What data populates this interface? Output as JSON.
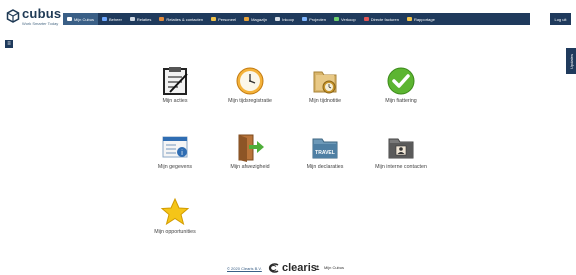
{
  "brand": {
    "name": "cubus",
    "tagline": "Work Smarter Today"
  },
  "nav": {
    "items": [
      {
        "label": "Mijn Cubus",
        "icon": "user-icon",
        "color": "#ffffff"
      },
      {
        "label": "Beheer",
        "icon": "cog-icon",
        "color": "#6ea8ff"
      },
      {
        "label": "Relaties",
        "icon": "contacts-icon",
        "color": "#cfd8e3"
      },
      {
        "label": "Relaties & contacten",
        "icon": "people-icon",
        "color": "#e08a3c"
      },
      {
        "label": "Personeel",
        "icon": "staff-icon",
        "color": "#f0c24a"
      },
      {
        "label": "Magazijn",
        "icon": "warehouse-icon",
        "color": "#e8a33a"
      },
      {
        "label": "Inkoop",
        "icon": "cart-icon",
        "color": "#d6dde6"
      },
      {
        "label": "Projecten",
        "icon": "projects-icon",
        "color": "#7fb6ff"
      },
      {
        "label": "Verkoop",
        "icon": "sales-icon",
        "color": "#6ccf6c"
      },
      {
        "label": "Directe facturen",
        "icon": "invoice-icon",
        "color": "#e25555"
      },
      {
        "label": "Rapportage",
        "icon": "report-icon",
        "color": "#f0c24a"
      }
    ],
    "logout_label": "Log uit",
    "side_tab_label": "Updates"
  },
  "tiles": [
    {
      "label": "Mijn acties",
      "icon": "checklist-icon"
    },
    {
      "label": "Mijn tijdsregistratie",
      "icon": "clock-icon"
    },
    {
      "label": "Mijn tijdnotitie",
      "icon": "folder-clock-icon"
    },
    {
      "label": "Mijn fiattering",
      "icon": "approve-check-icon"
    },
    {
      "label": "Mijn gegevens",
      "icon": "user-details-icon"
    },
    {
      "label": "Mijn afwezigheid",
      "icon": "exit-door-icon"
    },
    {
      "label": "Mijn declaraties",
      "icon": "travel-folder-icon"
    },
    {
      "label": "Mijn interne contacten",
      "icon": "contacts-folder-icon"
    },
    {
      "label": "Mijn opportunities",
      "icon": "star-icon"
    }
  ],
  "footer": {
    "copyright": "© 2020 Clearis B.V.",
    "company": "clearis",
    "user_label": "Mijn Cubus"
  },
  "colors": {
    "navbar": "#1f3a5c",
    "active_nav": "#3a5f86"
  }
}
